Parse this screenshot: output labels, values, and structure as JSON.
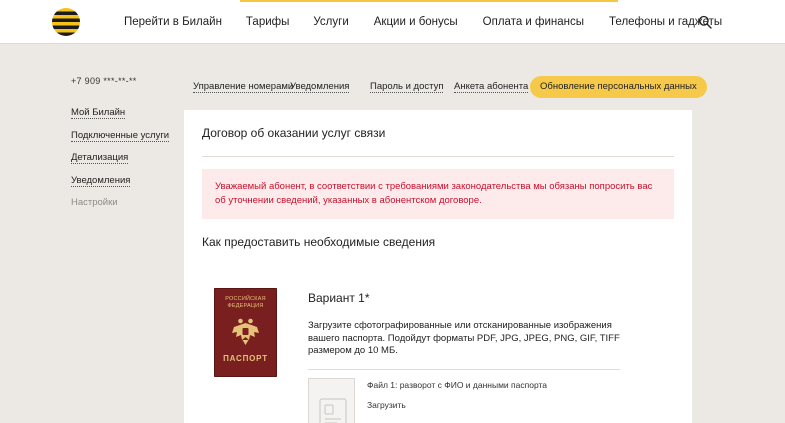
{
  "header": {
    "logo": "beeline-logo",
    "nav": [
      "Перейти в Билайн",
      "Тарифы",
      "Услуги",
      "Акции и бонусы",
      "Оплата и финансы",
      "Телефоны и гаджеты"
    ],
    "search_icon": "search-icon"
  },
  "sidebar": {
    "phone": "+7 909 ***-**-**",
    "items": [
      {
        "label": "Мой Билайн"
      },
      {
        "label": "Подключенные услуги"
      },
      {
        "label": "Детализация"
      },
      {
        "label": "Уведомления"
      },
      {
        "label": "Настройки"
      }
    ]
  },
  "tabs": {
    "items": [
      "Управление номерами",
      "Уведомления",
      "Пароль и доступ",
      "Анкета абонента"
    ],
    "active": "Обновление персональных данных"
  },
  "card": {
    "title": "Договор об оказании услуг связи",
    "alert_line1": "Уважаемый абонент, в соответствии с требованиями законодательства мы обязаны попросить вас",
    "alert_line2": "об уточнении сведений, указанных в абонентском договоре.",
    "section_title": "Как предоставить необходимые сведения",
    "passport": {
      "top_line1": "РОССИЙСКАЯ",
      "top_line2": "ФЕДЕРАЦИЯ",
      "label": "ПАСПОРТ"
    },
    "variant_title": "Вариант 1*",
    "variant_desc_line1": "Загрузите сфотографированные или отсканированные изображения",
    "variant_desc_line2": "вашего паспорта. Подойдут форматы PDF, JPG, JPEG, PNG, GIF, TIFF",
    "variant_desc_line3": "размером до 10 МБ.",
    "file_label": "Файл 1: разворот с ФИО и данными паспорта",
    "upload_label": "Загрузить"
  },
  "colors": {
    "accent_yellow": "#f7c94a",
    "alert_bg": "#fdeaea",
    "alert_text": "#c8102e",
    "passport_red": "#7a1f1f"
  }
}
